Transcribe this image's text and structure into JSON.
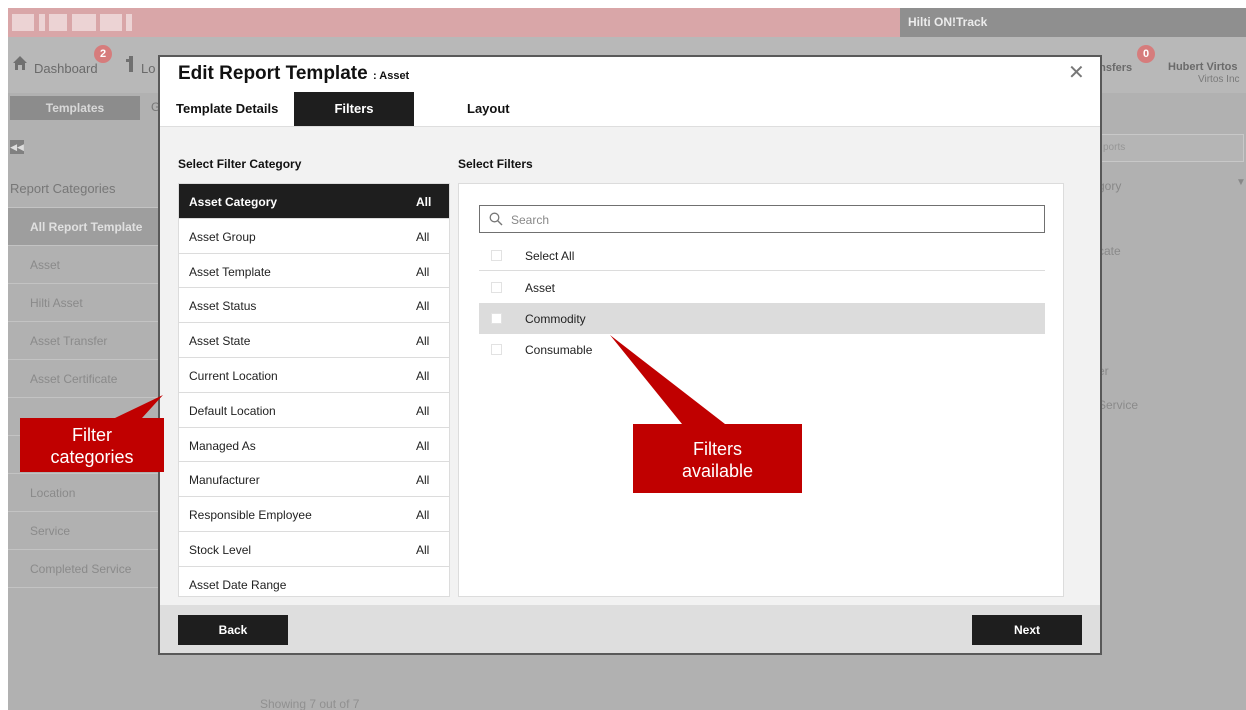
{
  "app": {
    "product_name": "Hilti ON!Track",
    "logo_text": "HILTI",
    "colors": {
      "brand": "#d9a6a8",
      "accent_dark": "#1e1e1e",
      "callout": "#c00000"
    }
  },
  "nav": {
    "dashboard_label": "Dashboard",
    "dashboard_badge": "2",
    "locations_label_partial": "Lo",
    "transfers_label_partial": "ansfers",
    "transfers_badge": "0",
    "user_name": "Hubert Virtos",
    "user_company": "Virtos Inc"
  },
  "page_tabs": {
    "templates": "Templates",
    "second_partial": "G"
  },
  "sidebar": {
    "header": "Report Categories",
    "items": [
      {
        "label": "All Report Template",
        "active": true
      },
      {
        "label": "Asset"
      },
      {
        "label": "Hilti Asset"
      },
      {
        "label": "Asset Transfer"
      },
      {
        "label": "Asset Certificate"
      },
      {
        "label": ""
      },
      {
        "label": ""
      },
      {
        "label": "Location"
      },
      {
        "label": "Service"
      },
      {
        "label": "Completed Service"
      }
    ]
  },
  "background_right": {
    "search_placeholder_partial": "ports",
    "category_partial": "gory",
    "texts": [
      "cate",
      "er",
      "Service"
    ]
  },
  "showing_text": "Showing 7 out of 7",
  "modal": {
    "title": "Edit Report Template",
    "subtitle": ": Asset",
    "tabs": [
      {
        "label": "Template Details",
        "active": false
      },
      {
        "label": "Filters",
        "active": true
      },
      {
        "label": "Layout",
        "active": false
      }
    ],
    "category_header": "Select Filter Category",
    "filters_header": "Select Filters",
    "categories": [
      {
        "name": "Asset Category",
        "value": "All",
        "active": true
      },
      {
        "name": "Asset Group",
        "value": "All"
      },
      {
        "name": "Asset Template",
        "value": "All"
      },
      {
        "name": "Asset Status",
        "value": "All"
      },
      {
        "name": "Asset State",
        "value": "All"
      },
      {
        "name": "Current Location",
        "value": "All"
      },
      {
        "name": "Default Location",
        "value": "All"
      },
      {
        "name": "Managed As",
        "value": "All"
      },
      {
        "name": "Manufacturer",
        "value": "All"
      },
      {
        "name": "Responsible Employee",
        "value": "All"
      },
      {
        "name": "Stock Level",
        "value": "All"
      },
      {
        "name": "Asset Date Range",
        "value": ""
      }
    ],
    "search_placeholder": "Search",
    "select_all_label": "Select All",
    "filter_options": [
      {
        "label": "Asset",
        "highlighted": false
      },
      {
        "label": "Commodity",
        "highlighted": true
      },
      {
        "label": "Consumable",
        "highlighted": false
      }
    ],
    "back_label": "Back",
    "next_label": "Next"
  },
  "callouts": {
    "categories": "Filter categories",
    "categories_line1": "Filter",
    "categories_line2": "categories",
    "filters": "Filters available",
    "filters_line1": "Filters",
    "filters_line2": "available"
  }
}
